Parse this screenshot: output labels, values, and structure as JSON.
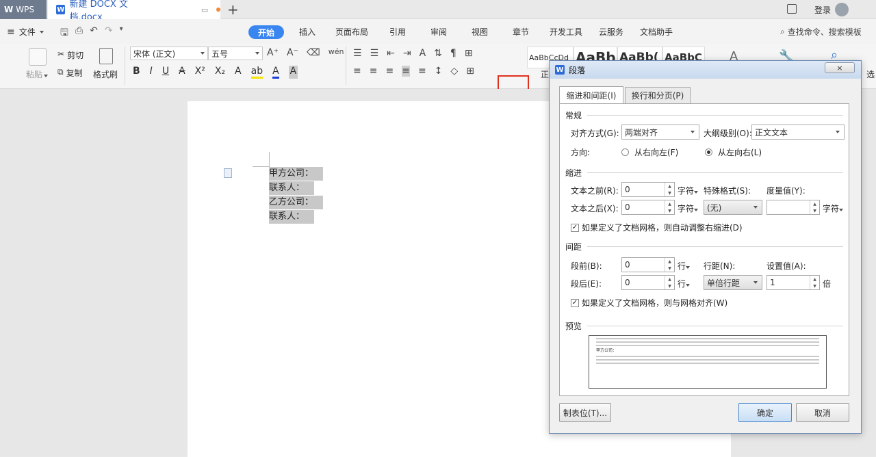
{
  "titlebar": {
    "app_label": "WPS",
    "doc_tab_title": "新建 DOCX 文档.docx",
    "new_tab": "+",
    "login": "登录"
  },
  "menu": {
    "file": "文件",
    "tabs": [
      "开始",
      "插入",
      "页面布局",
      "引用",
      "审阅",
      "视图",
      "章节",
      "开发工具",
      "云服务",
      "文档助手"
    ],
    "search": "查找命令、搜索模板"
  },
  "ribbon": {
    "paste": "粘贴",
    "cut": "剪切",
    "copy": "复制",
    "format_painter": "格式刷",
    "font_name": "宋体 (正文)",
    "font_size": "五号",
    "style1": "AaBbCcDd",
    "style1_caption": "正",
    "style2": "AaBb",
    "style3": "AaBb(",
    "style4": "AaBbC",
    "select": "选"
  },
  "document": {
    "lines": [
      "甲方公司：",
      "联系人：",
      "乙方公司：",
      "联系人："
    ]
  },
  "dialog": {
    "title": "段落",
    "close": "×",
    "tab_indent": "缩进和间距(I)",
    "tab_breaks": "换行和分页(P)",
    "general": {
      "title": "常规",
      "align_label": "对齐方式(G):",
      "align_value": "两端对齐",
      "outline_label": "大纲级别(O):",
      "outline_value": "正文文本",
      "direction_label": "方向:",
      "rtl": "从右向左(F)",
      "ltr": "从左向右(L)"
    },
    "indent": {
      "title": "缩进",
      "before_label": "文本之前(R):",
      "before_value": "0",
      "before_unit": "字符",
      "after_label": "文本之后(X):",
      "after_value": "0",
      "after_unit": "字符",
      "special_label": "特殊格式(S):",
      "special_value": "(无)",
      "measure_label": "度量值(Y):",
      "measure_value": "",
      "measure_unit": "字符",
      "auto_adjust": "如果定义了文档网格，则自动调整右缩进(D)"
    },
    "spacing": {
      "title": "间距",
      "before_label": "段前(B):",
      "before_value": "0",
      "before_unit": "行",
      "after_label": "段后(E):",
      "after_value": "0",
      "after_unit": "行",
      "line_label": "行距(N):",
      "line_value": "单倍行距",
      "set_label": "设置值(A):",
      "set_value": "1",
      "set_unit": "倍",
      "snap_grid": "如果定义了文档网格，则与网格对齐(W)"
    },
    "preview_title": "预览",
    "preview_text": "甲方公司：",
    "tabs_button": "制表位(T)...",
    "ok": "确定",
    "cancel": "取消"
  }
}
